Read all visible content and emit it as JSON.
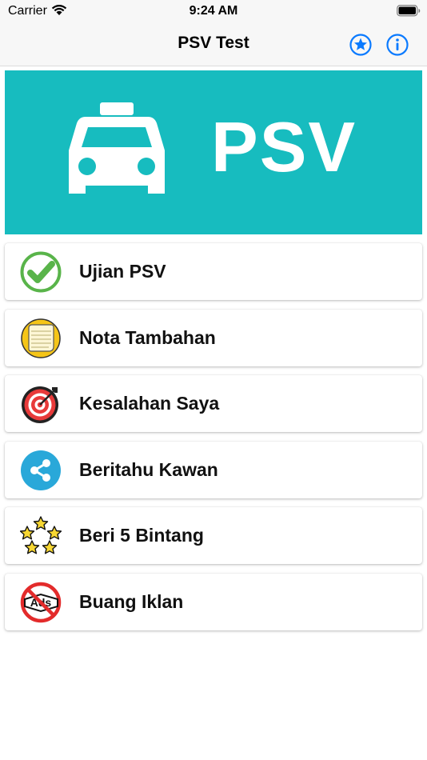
{
  "status_bar": {
    "carrier": "Carrier",
    "time": "9:24 AM"
  },
  "nav": {
    "title": "PSV Test",
    "star_icon": "star-circle-icon",
    "info_icon": "info-circle-icon",
    "accent": "#0a7aff"
  },
  "banner": {
    "text": "PSV",
    "background": "#17bcbf",
    "icon": "taxi-car-icon"
  },
  "menu": {
    "items": [
      {
        "label": "Ujian PSV",
        "icon": "checkmark-icon"
      },
      {
        "label": "Nota Tambahan",
        "icon": "notepad-icon"
      },
      {
        "label": "Kesalahan Saya",
        "icon": "target-icon"
      },
      {
        "label": "Beritahu Kawan",
        "icon": "share-icon"
      },
      {
        "label": "Beri 5 Bintang",
        "icon": "five-stars-icon"
      },
      {
        "label": "Buang Iklan",
        "icon": "no-ads-icon"
      }
    ]
  }
}
